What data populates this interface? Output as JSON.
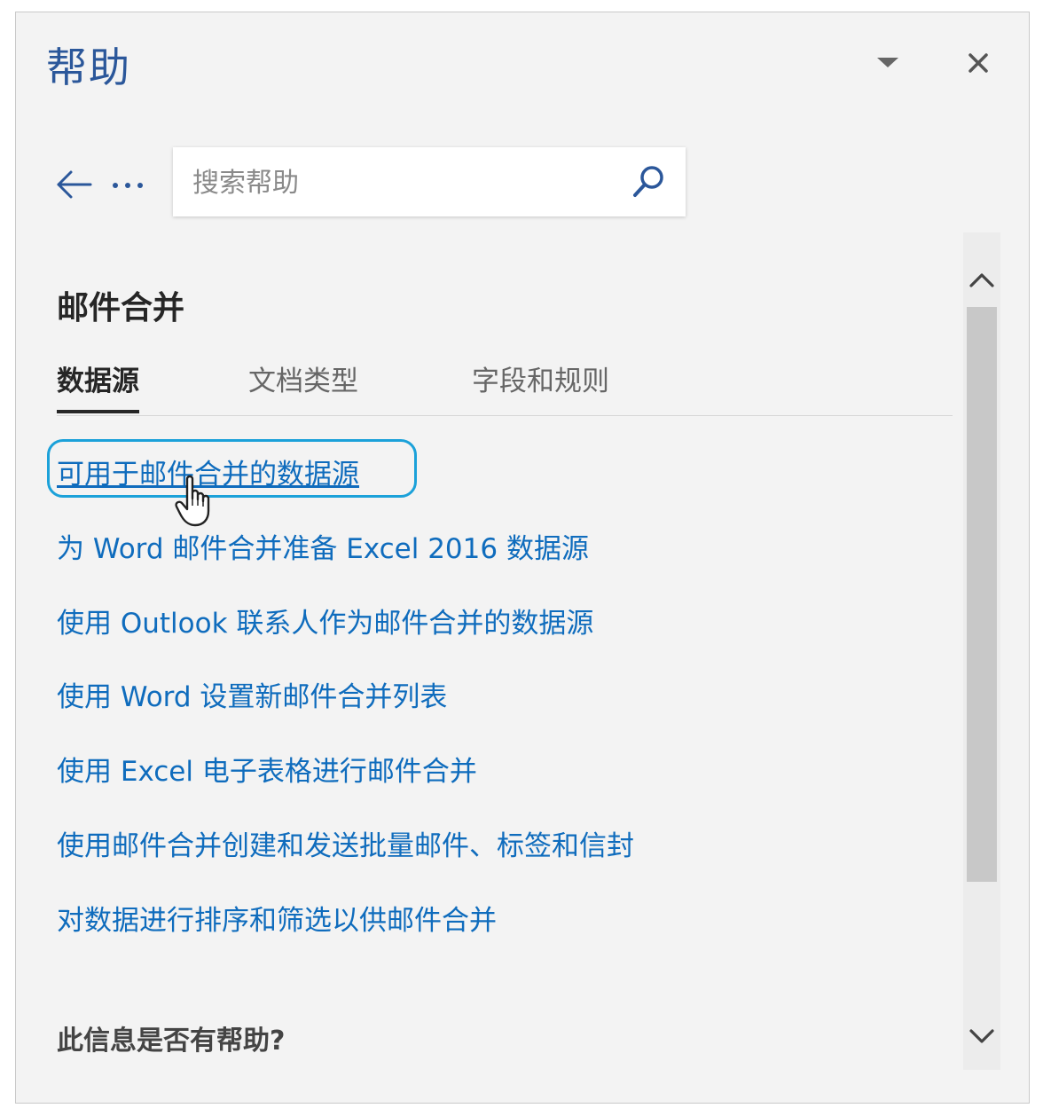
{
  "pane": {
    "title": "帮助",
    "dropdown_icon": "chevron-down-icon",
    "close_icon": "close-icon"
  },
  "nav": {
    "back_icon": "arrow-left-icon",
    "more_icon": "ellipsis-icon"
  },
  "search": {
    "placeholder": "搜索帮助",
    "value": "",
    "icon": "search-icon"
  },
  "section": {
    "title": "邮件合并"
  },
  "tabs": [
    {
      "label": "数据源",
      "active": true
    },
    {
      "label": "文档类型",
      "active": false
    },
    {
      "label": "字段和规则",
      "active": false
    }
  ],
  "links": [
    {
      "label": "可用于邮件合并的数据源",
      "focused": true
    },
    {
      "label": "为 Word 邮件合并准备 Excel 2016 数据源"
    },
    {
      "label": "使用 Outlook 联系人作为邮件合并的数据源"
    },
    {
      "label": "使用 Word 设置新邮件合并列表"
    },
    {
      "label": "使用 Excel 电子表格进行邮件合并"
    },
    {
      "label": "使用邮件合并创建和发送批量邮件、标签和信封"
    },
    {
      "label": "对数据进行排序和筛选以供邮件合并"
    }
  ],
  "feedback": {
    "question": "此信息是否有帮助?"
  },
  "colors": {
    "title": "#2b579a",
    "link": "#0f6cbd",
    "focus_ring": "#1ba1d9",
    "pane_background": "#f3f3f3"
  }
}
